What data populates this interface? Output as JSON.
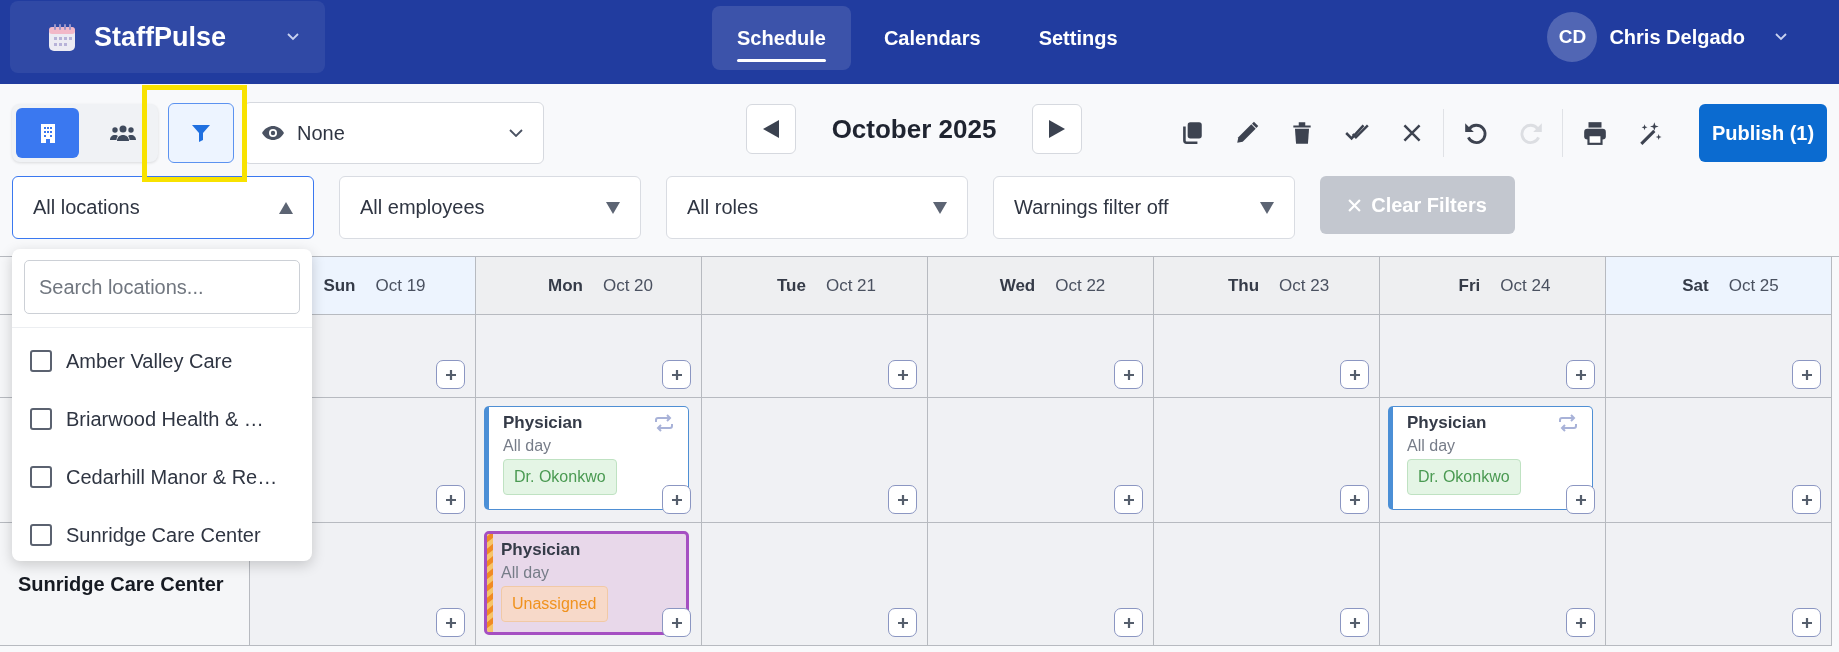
{
  "app": {
    "name": "StaffPulse"
  },
  "nav": [
    {
      "label": "Schedule",
      "selected": true
    },
    {
      "label": "Calendars",
      "selected": false
    },
    {
      "label": "Settings",
      "selected": false
    }
  ],
  "user": {
    "initials": "CD",
    "name": "Chris Delgado"
  },
  "toolbar": {
    "view_modes": [
      {
        "kind": "locations",
        "selected": true
      },
      {
        "kind": "people",
        "selected": false
      }
    ],
    "filter": {
      "active": true,
      "highlighted": true
    },
    "view_select": {
      "value": "None"
    },
    "month": "October 2025",
    "actions": [
      {
        "kind": "copy",
        "disabled": false
      },
      {
        "kind": "edit",
        "disabled": false
      },
      {
        "kind": "delete",
        "disabled": false
      },
      {
        "kind": "approve",
        "disabled": false
      },
      {
        "kind": "cancel",
        "disabled": false
      },
      {
        "kind": "undo",
        "disabled": false
      },
      {
        "kind": "redo",
        "disabled": true
      },
      {
        "kind": "print",
        "disabled": false
      },
      {
        "kind": "magic",
        "disabled": false
      }
    ],
    "publish": "Publish (1)"
  },
  "filters": [
    {
      "value": "All locations",
      "open": true
    },
    {
      "value": "All employees",
      "open": false
    },
    {
      "value": "All roles",
      "open": false
    },
    {
      "value": "Warnings filter off",
      "open": false
    }
  ],
  "clear_filters": {
    "label": "Clear Filters",
    "disabled": true
  },
  "location_menu": {
    "placeholder": "Search locations...",
    "options": [
      {
        "label": "Amber Valley Care",
        "checked": false
      },
      {
        "label": "Briarwood Health & …",
        "checked": false
      },
      {
        "label": "Cedarhill Manor & Re…",
        "checked": false
      },
      {
        "label": "Sunridge Care Center",
        "checked": false
      }
    ]
  },
  "days": [
    {
      "day": "Sun",
      "date": "Oct 19",
      "weekend": true
    },
    {
      "day": "Mon",
      "date": "Oct 20",
      "weekend": false
    },
    {
      "day": "Tue",
      "date": "Oct 21",
      "weekend": false
    },
    {
      "day": "Wed",
      "date": "Oct 22",
      "weekend": false
    },
    {
      "day": "Thu",
      "date": "Oct 23",
      "weekend": false
    },
    {
      "day": "Fri",
      "date": "Oct 24",
      "weekend": false
    },
    {
      "day": "Sat",
      "date": "Oct 25",
      "weekend": true
    }
  ],
  "rows": [
    {
      "cells": [
        {},
        {},
        {},
        {},
        {},
        {},
        {}
      ]
    },
    {
      "cells": [
        {},
        {
          "shift": {
            "role": "Physician",
            "time": "All day",
            "assignee": "Dr. Okonkwo",
            "kind": "assigned",
            "recurring": true
          }
        },
        {},
        {},
        {},
        {
          "shift": {
            "role": "Physician",
            "time": "All day",
            "assignee": "Dr. Okonkwo",
            "kind": "assigned",
            "recurring": true
          }
        },
        {}
      ]
    },
    {
      "label": "Sunridge Care Center",
      "cells": [
        {},
        {
          "shift": {
            "role": "Physician",
            "time": "All day",
            "assignee": "Unassigned",
            "kind": "unassigned",
            "recurring": false
          }
        },
        {},
        {},
        {},
        {},
        {}
      ]
    }
  ]
}
